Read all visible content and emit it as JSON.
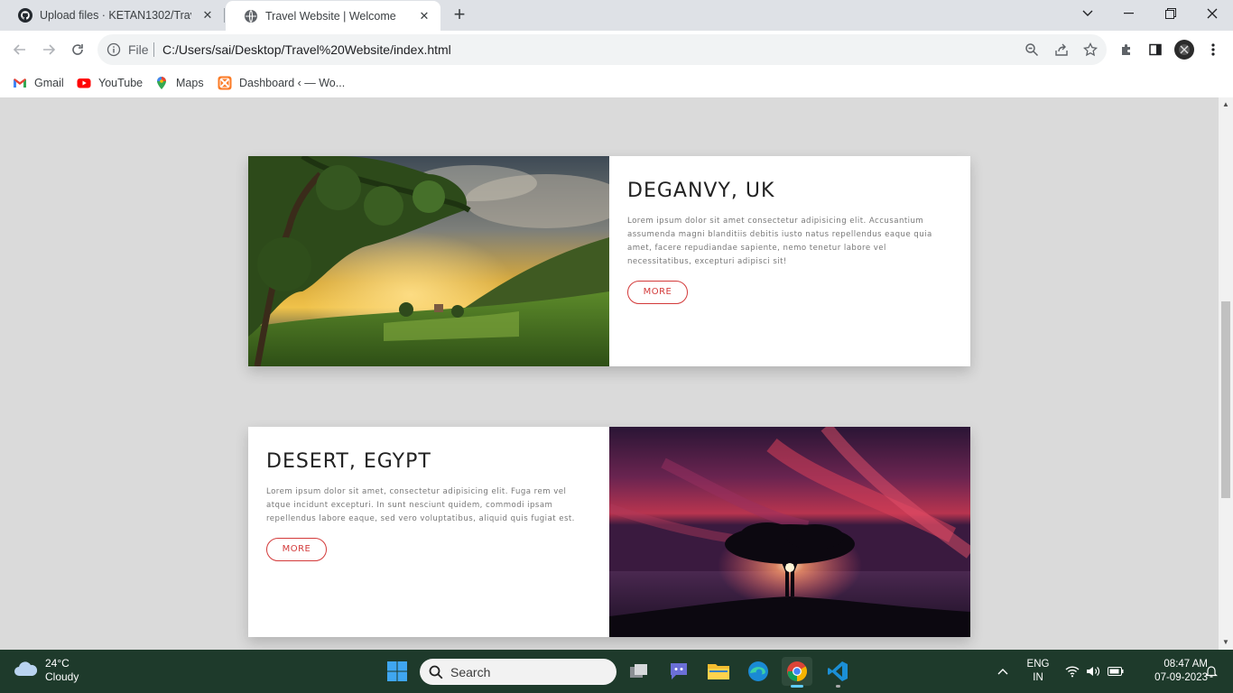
{
  "browser": {
    "tabs": [
      {
        "title": "Upload files · KETAN1302/Travel-W",
        "favicon": "github-icon"
      },
      {
        "title": "Travel Website | Welcome",
        "favicon": "globe-icon",
        "active": true
      }
    ],
    "address": {
      "scheme_label": "File",
      "url": "C:/Users/sai/Desktop/Travel%20Website/index.html"
    },
    "bookmarks": [
      {
        "label": "Gmail",
        "icon": "gmail-icon"
      },
      {
        "label": "YouTube",
        "icon": "youtube-icon"
      },
      {
        "label": "Maps",
        "icon": "maps-icon"
      },
      {
        "label": "Dashboard ‹ — Wo...",
        "icon": "xampp-icon"
      }
    ]
  },
  "page": {
    "cards": [
      {
        "title": "DEGANVY, UK",
        "text": "Lorem ipsum dolor sit amet consectetur adipisicing elit. Accusantium assumenda magni blanditiis debitis iusto natus repellendus eaque quia amet, facere repudiandae sapiente, nemo tenetur labore vel necessitatibus, excepturi adipisci sit!",
        "button": "MORE",
        "image": "landscape-sunset-photo"
      },
      {
        "title": "DESERT, EGYPT",
        "text": "Lorem ipsum dolor sit amet, consectetur adipisicing elit. Fuga rem vel atque incidunt excepturi. In sunt nesciunt quidem, commodi ipsam repellendus labore eaque, sed vero voluptatibus, aliquid quis fugiat est.",
        "button": "MORE",
        "image": "tree-red-sky-photo"
      }
    ]
  },
  "taskbar": {
    "weather": {
      "temp": "24°C",
      "condition": "Cloudy"
    },
    "search_placeholder": "Search",
    "language": {
      "line1": "ENG",
      "line2": "IN"
    },
    "clock": {
      "time": "08:47 AM",
      "date": "07-09-2023"
    }
  },
  "colors": {
    "accent": "#d33a3a",
    "page_bg": "#dadada",
    "taskbar_bg": "#1e3a2b"
  }
}
